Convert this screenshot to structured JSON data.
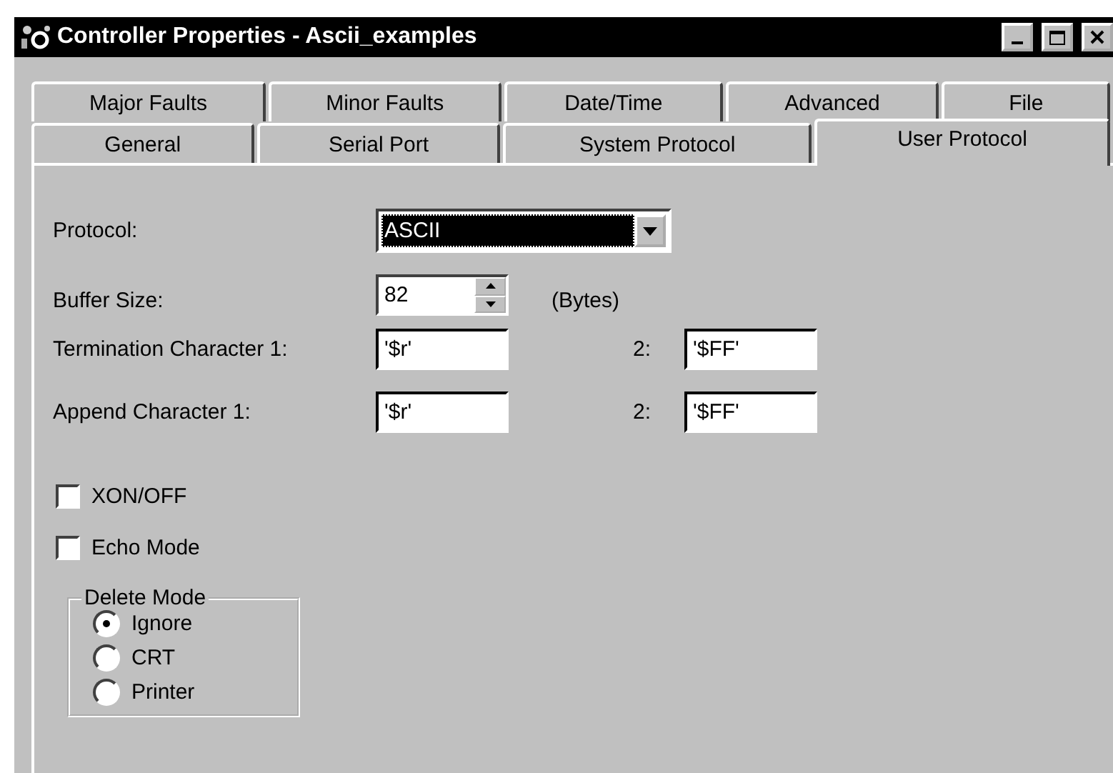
{
  "window": {
    "title": "Controller Properties - Ascii_examples"
  },
  "tab_rows": [
    {
      "tabs": [
        {
          "label": "Major Faults",
          "selected": false
        },
        {
          "label": "Minor Faults",
          "selected": false
        },
        {
          "label": "Date/Time",
          "selected": false
        },
        {
          "label": "Advanced",
          "selected": false
        },
        {
          "label": "File",
          "selected": false
        }
      ]
    },
    {
      "tabs": [
        {
          "label": "General",
          "selected": false
        },
        {
          "label": "Serial Port",
          "selected": false
        },
        {
          "label": "System Protocol",
          "selected": false
        },
        {
          "label": "User Protocol",
          "selected": true
        }
      ]
    }
  ],
  "protocol": {
    "label": "Protocol:",
    "value": "ASCII"
  },
  "buffer_size": {
    "label": "Buffer Size:",
    "value": "82",
    "unit": "(Bytes)"
  },
  "char_rows": [
    {
      "label": "Termination Character 1:",
      "value_1": "'$r'",
      "label_2": "2:",
      "value_2": "'$FF'"
    },
    {
      "label": "Append Character 1:",
      "value_1": "'$r'",
      "label_2": "2:",
      "value_2": "'$FF'"
    }
  ],
  "checkboxes": [
    {
      "label": "XON/OFF",
      "checked": false
    },
    {
      "label": "Echo Mode",
      "checked": false
    }
  ],
  "delete_mode": {
    "title": "Delete Mode",
    "options": [
      {
        "label": "Ignore",
        "selected": true
      },
      {
        "label": "CRT",
        "selected": false
      },
      {
        "label": "Printer",
        "selected": false
      }
    ]
  }
}
